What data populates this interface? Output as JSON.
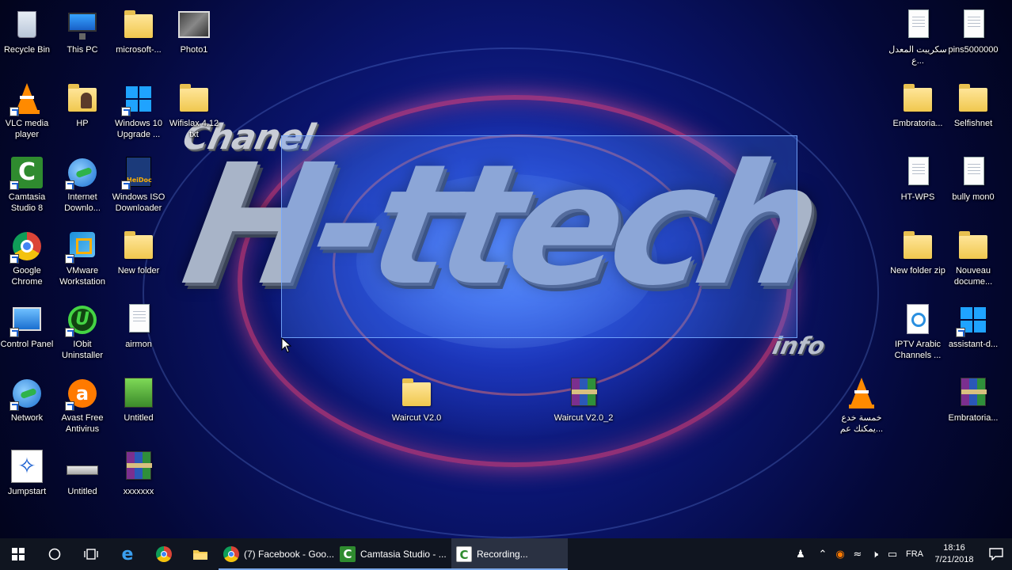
{
  "desktop": {
    "background_colors": {
      "deep": "#040838",
      "mid": "#1b2fae",
      "ring": "#ff4678"
    },
    "wallpaper_logo": {
      "line1": "Chanel",
      "line2": "H-ttech",
      "line3": "info"
    },
    "icons": [
      {
        "label": "Recycle Bin",
        "icon": "recycle-bin-icon"
      },
      {
        "label": "This PC",
        "icon": "this-pc-icon"
      },
      {
        "label": "microsoft-...",
        "icon": "folder-icon"
      },
      {
        "label": "Photo1",
        "icon": "photo-icon"
      },
      {
        "label": "VLC media player",
        "icon": "vlc-icon"
      },
      {
        "label": "HP",
        "icon": "user-folder-icon"
      },
      {
        "label": "Windows 10 Upgrade ...",
        "icon": "windows-icon"
      },
      {
        "label": "Wifislax 4.12 txt",
        "icon": "folder-icon"
      },
      {
        "label": "Camtasia Studio 8",
        "icon": "camtasia-icon"
      },
      {
        "label": "Internet Downlo...",
        "icon": "idm-globe-icon"
      },
      {
        "label": "Windows ISO Downloader",
        "icon": "iso-downloader-icon"
      },
      {
        "label": "Google Chrome",
        "icon": "chrome-icon"
      },
      {
        "label": "VMware Workstation",
        "icon": "vmware-icon"
      },
      {
        "label": "New folder",
        "icon": "folder-icon"
      },
      {
        "label": "Control Panel",
        "icon": "control-panel-icon"
      },
      {
        "label": "IObit Uninstaller",
        "icon": "iobit-icon"
      },
      {
        "label": "airmon",
        "icon": "text-file-icon"
      },
      {
        "label": "Network",
        "icon": "network-icon"
      },
      {
        "label": "Avast Free Antivirus",
        "icon": "avast-icon"
      },
      {
        "label": "Untitled",
        "icon": "image-file-icon"
      },
      {
        "label": "Jumpstart",
        "icon": "jumpstart-icon"
      },
      {
        "label": "Untitled",
        "icon": "drive-icon"
      },
      {
        "label": "xxxxxxx",
        "icon": "rar-icon"
      },
      {
        "label": "Waircut V2.0",
        "icon": "folder-icon"
      },
      {
        "label": "Waircut V2.0_2",
        "icon": "rar-icon"
      },
      {
        "label": "سكريبت المعدل ع...",
        "icon": "text-file-icon"
      },
      {
        "label": "pins5000000",
        "icon": "text-file-icon"
      },
      {
        "label": "Embratoria...",
        "icon": "folder-icon"
      },
      {
        "label": "Selfishnet",
        "icon": "folder-icon"
      },
      {
        "label": "HT-WPS",
        "icon": "text-file-icon"
      },
      {
        "label": "bully mon0",
        "icon": "text-file-icon"
      },
      {
        "label": "New folder zip",
        "icon": "folder-icon"
      },
      {
        "label": "Nouveau docume...",
        "icon": "folder-icon"
      },
      {
        "label": "IPTV Arabic Channels ...",
        "icon": "iptv-icon"
      },
      {
        "label": "assistant-d...",
        "icon": "windows-icon"
      },
      {
        "label": "خمسة خدع يمكنك عم...",
        "icon": "vlc-icon"
      },
      {
        "label": "Embratoria...",
        "icon": "rar-icon"
      }
    ]
  },
  "taskbar": {
    "color": "#101520",
    "pinned": [
      {
        "name": "start-button",
        "icon": "windows-logo-icon"
      },
      {
        "name": "search-button",
        "icon": "search-circle-icon"
      },
      {
        "name": "task-view-button",
        "icon": "task-view-icon"
      },
      {
        "name": "edge-button",
        "icon": "edge-icon"
      },
      {
        "name": "chrome-button",
        "icon": "chrome-icon"
      },
      {
        "name": "file-explorer-button",
        "icon": "folder-icon"
      }
    ],
    "apps": [
      {
        "title": "(7) Facebook - Goo...",
        "icon": "chrome-icon"
      },
      {
        "title": "Camtasia Studio - ...",
        "icon": "camtasia-icon"
      },
      {
        "title": "Recording...",
        "icon": "camtasia-recorder-icon"
      }
    ],
    "tray": {
      "language": "FRA",
      "time": "18:16",
      "date": "7/21/2018"
    }
  }
}
